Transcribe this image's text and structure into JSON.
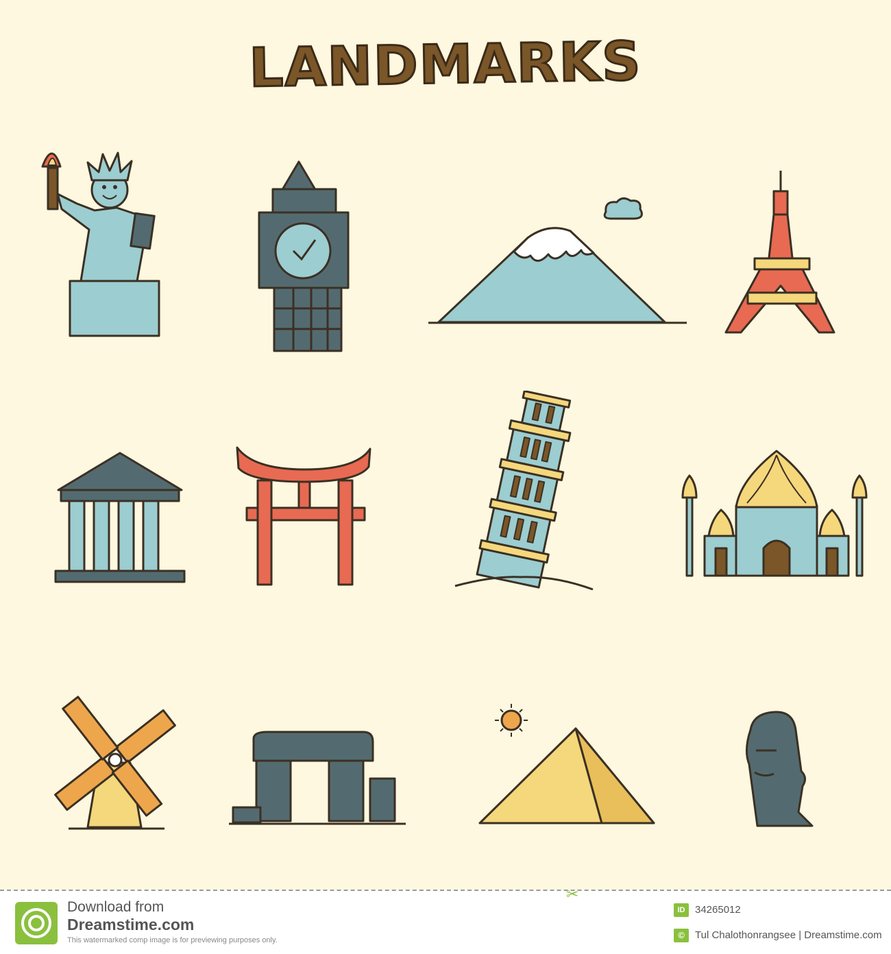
{
  "title": "LANDMARKS",
  "colors": {
    "background": "#fdf8df",
    "outline": "#3b3024",
    "blue": "#9ccdd0",
    "slate": "#536b70",
    "red": "#e86a52",
    "yellow": "#f5d77c",
    "orange": "#eea64c",
    "brown": "#7a5628",
    "footer_accent": "#8ac03e"
  },
  "icons": [
    {
      "name": "statue-of-liberty-icon"
    },
    {
      "name": "big-ben-icon"
    },
    {
      "name": "mount-fuji-icon"
    },
    {
      "name": "eiffel-tower-icon"
    },
    {
      "name": "parthenon-icon"
    },
    {
      "name": "torii-gate-icon"
    },
    {
      "name": "leaning-tower-of-pisa-icon"
    },
    {
      "name": "taj-mahal-icon"
    },
    {
      "name": "windmill-icon"
    },
    {
      "name": "stonehenge-icon"
    },
    {
      "name": "pyramid-icon"
    },
    {
      "name": "moai-icon"
    }
  ],
  "footer": {
    "download_line1": "Download from",
    "download_line2": "Dreamstime.com",
    "note": "This watermarked comp image is for previewing purposes only.",
    "id_label": "ID",
    "id_value": "34265012",
    "copyright_symbol": "©",
    "credit": "Tul Chalothonrangsee | Dreamstime.com"
  }
}
